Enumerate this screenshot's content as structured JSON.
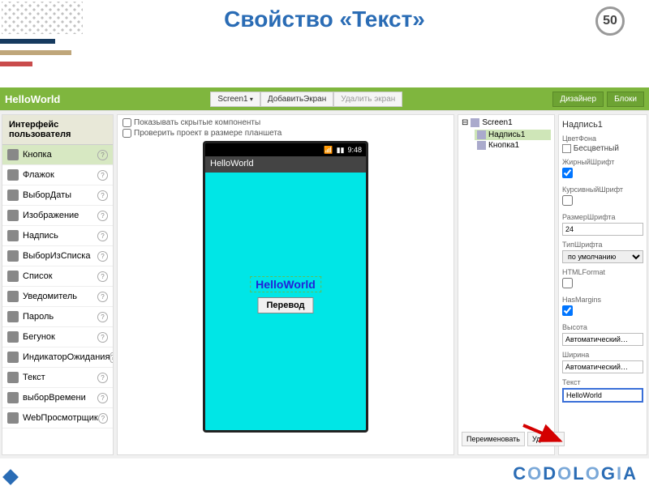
{
  "slide": {
    "title": "Свойство «Текст»",
    "number": "50"
  },
  "toolbar": {
    "appName": "HelloWorld",
    "screen": "Screen1",
    "addScreen": "ДобавитьЭкран",
    "deleteScreen": "Удалить экран",
    "designer": "Дизайнер",
    "blocks": "Блоки"
  },
  "palette": {
    "header": "Интерфейс пользователя",
    "items": [
      "Кнопка",
      "Флажок",
      "ВыборДаты",
      "Изображение",
      "Надпись",
      "ВыборИзСписка",
      "Список",
      "Уведомитель",
      "Пароль",
      "Бегунок",
      "ИндикаторОжидания",
      "Текст",
      "выборВремени",
      "WebПросмотрщик"
    ],
    "selectedIndex": 0
  },
  "viewer": {
    "showHidden": "Показывать скрытые компоненты",
    "tabletCheck": "Проверить проект в размере планшета",
    "phoneTime": "9:48",
    "phoneAppTitle": "HelloWorld",
    "helloLabel": "HelloWorld",
    "translateBtn": "Перевод"
  },
  "tree": {
    "root": "Screen1",
    "children": [
      "Надпись1",
      "Кнопка1"
    ],
    "selectedIndex": 0,
    "rename": "Переименовать",
    "delete": "Удалить"
  },
  "props": {
    "header": "Надпись1",
    "bgColorLabel": "ЦветФона",
    "bgColorVal": "Бесцветный",
    "boldLabel": "ЖирныйШрифт",
    "italicLabel": "КурсивныйШрифт",
    "fontSizeLabel": "РазмерШрифта",
    "fontSizeVal": "24",
    "fontTypeLabel": "ТипШрифта",
    "fontTypeVal": "по умолчанию",
    "htmlLabel": "HTMLFormat",
    "marginsLabel": "HasMargins",
    "heightLabel": "Высота",
    "heightVal": "Автоматический…",
    "widthLabel": "Ширина",
    "widthVal": "Автоматический…",
    "textLabel": "Текст",
    "textVal": "HelloWorld"
  },
  "brand": "CODOLOGIA"
}
